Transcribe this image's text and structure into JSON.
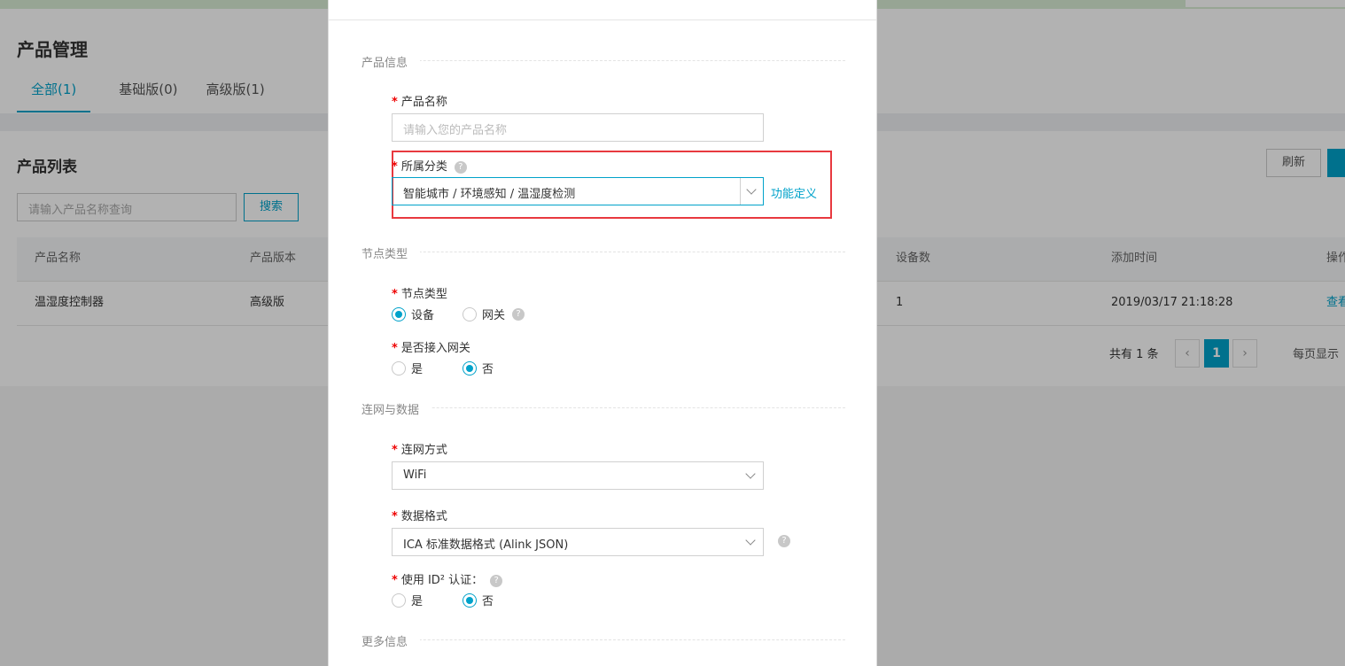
{
  "page": {
    "title": "产品管理",
    "tabs": [
      {
        "label": "全部(1)"
      },
      {
        "label": "基础版(0)"
      },
      {
        "label": "高级版(1)"
      }
    ]
  },
  "product_list": {
    "title": "产品列表",
    "search_placeholder": "请输入产品名称查询",
    "search_button": "搜索",
    "refresh_button": "刷新",
    "columns": [
      "产品名称",
      "产品版本",
      "设备数",
      "添加时间",
      "操作"
    ],
    "rows": [
      {
        "name": "温湿度控制器",
        "version": "高级版",
        "devices": "1",
        "added": "2019/03/17 21:18:28",
        "action": "查看"
      }
    ],
    "pager": {
      "total": "共有 1 条",
      "prev": "‹",
      "current": "1",
      "next": "›",
      "per_page": "每页显示"
    }
  },
  "modal": {
    "sections": {
      "product_info": "产品信息",
      "node_type": "节点类型",
      "network_data": "连网与数据",
      "more_info": "更多信息"
    },
    "fields": {
      "product_name": {
        "label": "产品名称",
        "placeholder": "请输入您的产品名称"
      },
      "category": {
        "label": "所属分类",
        "value": "智能城市 / 环境感知 / 温湿度检测",
        "link": "功能定义"
      },
      "node_type": {
        "label": "节点类型",
        "options": [
          "设备",
          "网关"
        ],
        "selected": "设备"
      },
      "gateway": {
        "label": "是否接入网关",
        "options": [
          "是",
          "否"
        ],
        "selected": "否"
      },
      "network": {
        "label": "连网方式",
        "value": "WiFi"
      },
      "data_format": {
        "label": "数据格式",
        "value": "ICA 标准数据格式 (Alink JSON)"
      },
      "id2_auth": {
        "label": "使用 ID² 认证：",
        "options": [
          "是",
          "否"
        ],
        "selected": "否"
      }
    },
    "help_glyph": "?"
  },
  "colors": {
    "accent": "#00a2ca",
    "required": "#e00000",
    "highlight": "#e8393f"
  }
}
